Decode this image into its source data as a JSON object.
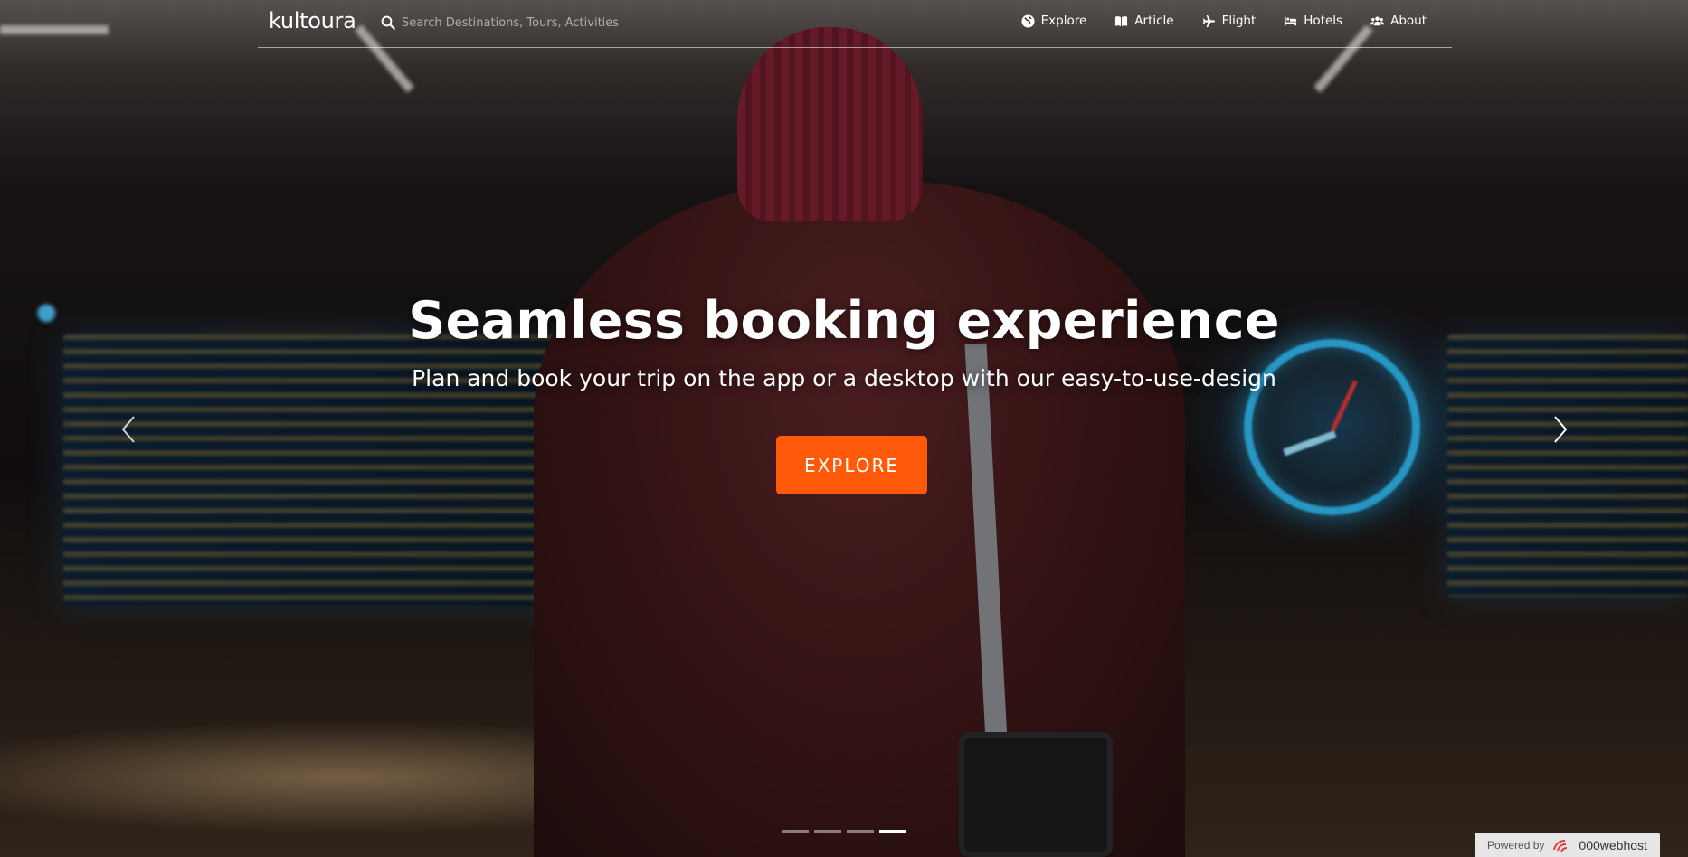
{
  "header": {
    "brand": "kultoura",
    "search": {
      "placeholder": "Search Destinations, Tours, Activities",
      "icon": "search-icon"
    },
    "nav": [
      {
        "label": "Explore",
        "icon": "globe-icon"
      },
      {
        "label": "Article",
        "icon": "book-icon"
      },
      {
        "label": "Flight",
        "icon": "plane-icon"
      },
      {
        "label": "Hotels",
        "icon": "bed-icon"
      },
      {
        "label": "About",
        "icon": "users-icon"
      }
    ]
  },
  "hero": {
    "title": "Seamless booking experience",
    "subtitle": "Plan and book your trip on the app or a desktop with our easy-to-use-design",
    "cta_label": "EXPLORE",
    "cta_color": "#ff5a0a"
  },
  "carousel": {
    "slide_count": 4,
    "active_slide": 4
  },
  "footer_badge": {
    "prefix": "Powered by",
    "brand": "000webhost"
  }
}
